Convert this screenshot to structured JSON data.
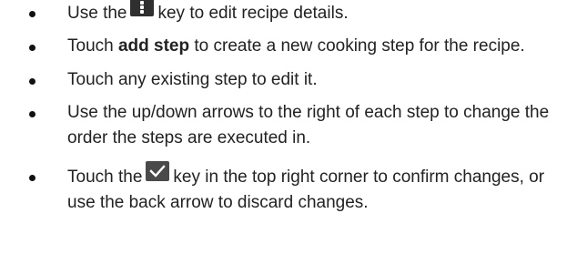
{
  "instructions": {
    "item1": {
      "before": "Use the",
      "icon": "menu-key-icon",
      "after": "key to edit recipe details."
    },
    "item2": {
      "before": "Touch",
      "bold": "add step",
      "after": "to create a new cooking step for the recipe."
    },
    "item3": {
      "text": "Touch any existing step to edit it."
    },
    "item4": {
      "text": "Use the up/down arrows to the right of each step to change the order the steps are executed in."
    },
    "item5": {
      "before": "Touch the",
      "icon": "checkmark-key-icon",
      "after": "key in the top right corner to confirm changes, or use the back arrow to discard changes."
    }
  }
}
